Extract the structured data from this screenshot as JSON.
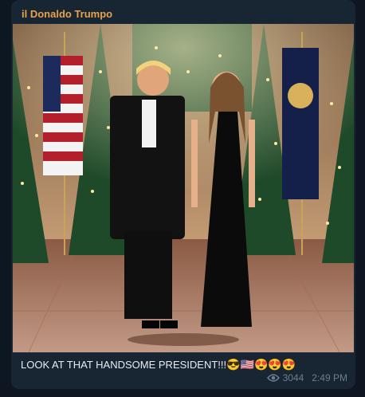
{
  "post": {
    "sender": "il Donaldo Trumpo",
    "caption_text": "LOOK AT THAT HANDSOME PRESIDENT!!!",
    "caption_emojis": "😎🇺🇸😍😍😍",
    "views": "3044",
    "time": "2:49 PM"
  },
  "photo": {
    "description_icon": "photo-image"
  },
  "colors": {
    "background": "#0e1621",
    "bubble": "#182533",
    "sender": "#e8a24a",
    "meta": "#6d7f8f"
  }
}
